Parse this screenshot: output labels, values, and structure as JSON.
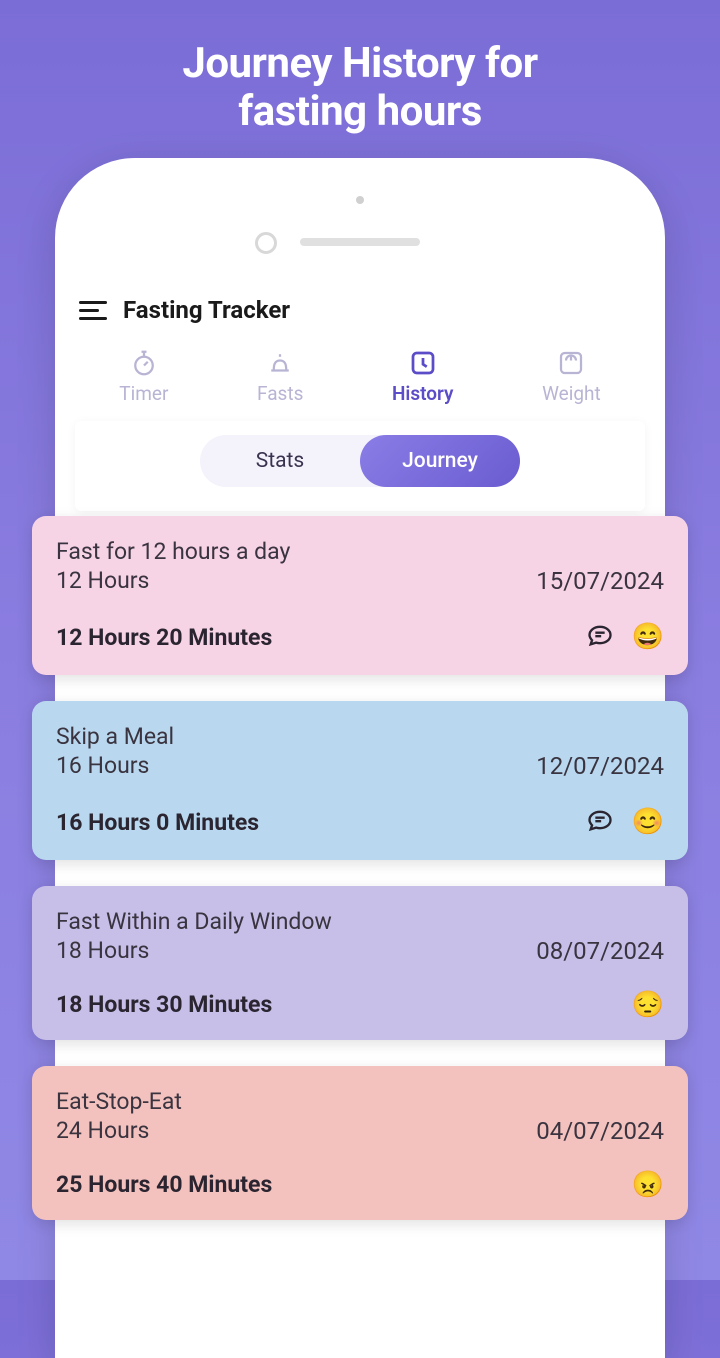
{
  "promo": {
    "title_line1": "Journey History for",
    "title_line2": "fasting hours"
  },
  "header": {
    "app_title": "Fasting Tracker"
  },
  "tabs": {
    "timer": {
      "label": "Timer"
    },
    "fasts": {
      "label": "Fasts"
    },
    "history": {
      "label": "History"
    },
    "weight": {
      "label": "Weight"
    }
  },
  "segmented": {
    "stats": "Stats",
    "journey": "Journey"
  },
  "entries": [
    {
      "title": "Fast for 12 hours a day",
      "target": "12 Hours",
      "date": "15/07/2024",
      "actual": "12 Hours 20 Minutes",
      "emoji": "😄",
      "has_comment": true,
      "color": "pink"
    },
    {
      "title": "Skip a Meal",
      "target": "16 Hours",
      "date": "12/07/2024",
      "actual": "16 Hours 0 Minutes",
      "emoji": "😊",
      "has_comment": true,
      "color": "blue"
    },
    {
      "title": "Fast Within a Daily Window",
      "target": "18 Hours",
      "date": "08/07/2024",
      "actual": "18 Hours 30 Minutes",
      "emoji": "😔",
      "has_comment": false,
      "color": "purple"
    },
    {
      "title": "Eat-Stop-Eat",
      "target": "24 Hours",
      "date": "04/07/2024",
      "actual": "25 Hours 40 Minutes",
      "emoji": "😠",
      "has_comment": false,
      "color": "coral"
    }
  ]
}
